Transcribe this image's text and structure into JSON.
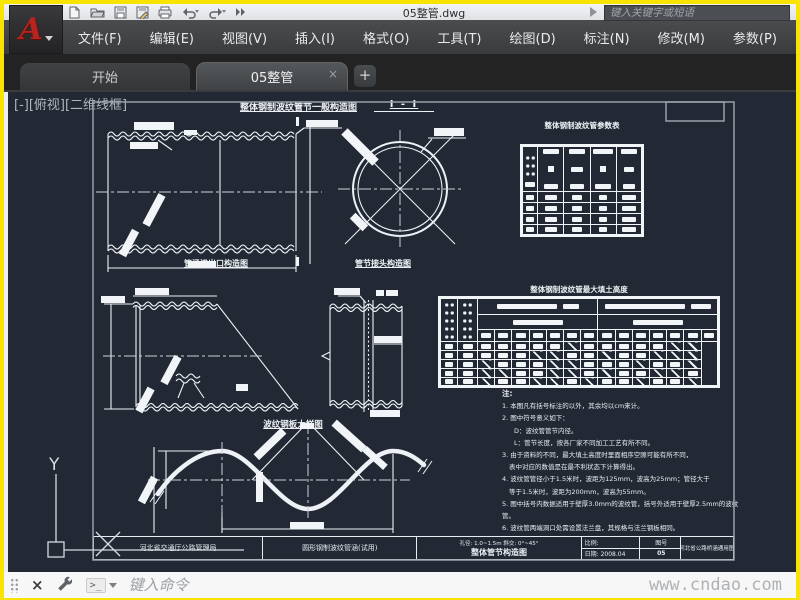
{
  "window": {
    "doc_title": "05整管.dwg",
    "search_placeholder": "键入关键字或短语",
    "qat_icons": [
      "new-file",
      "open-folder",
      "save",
      "save-as",
      "plot",
      "undo",
      "redo",
      "more"
    ],
    "border_color": "#f8e400"
  },
  "menu": {
    "items": [
      "文件(F)",
      "编辑(E)",
      "视图(V)",
      "插入(I)",
      "格式(O)",
      "工具(T)",
      "绘图(D)",
      "标注(N)",
      "修改(M)",
      "参数(P)"
    ]
  },
  "tabs": {
    "start": "开始",
    "active": "05整管",
    "close": "×",
    "new": "+"
  },
  "canvas": {
    "viewport_controls": "[-][俯视][二维线框]",
    "background": "#222834",
    "line_color": "#eef2f6",
    "ucs_y": "Y"
  },
  "drawing": {
    "title_general": "整体钢制波纹管节一般构造图",
    "section_label": "I - I",
    "param_table_title": "整体钢制波纹管参数表",
    "outlet_label": "管涵进出口构造图",
    "joint_label": "管节接头构造图",
    "fill_table_title": "整体钢制波纹管最大填土高度",
    "plate_label": "波纹钢板大样图",
    "notes_title": "注:",
    "notes": [
      "1. 本图凡有括号标注的以外，其余均以cm来计。",
      "2. 图中符号意义如下：",
      "D：波纹管管节内径。",
      "L：管节长度，按各厂家不同加工工艺有所不同。",
      "3. 由于资料的不同，最大填土高度时里面相序空隙可能有所不同，",
      "表中对应的数值是在最不利状态下计算得出。",
      "4. 波纹管管径小于1.5米时，波距为125mm，波高为25mm；管径大于",
      "等于1.5米时，波距为200mm，波高为55mm。",
      "5. 图中括号内数据适用于壁厚3.0mm的波纹管，括号外适用于壁厚2.5mm的波纹管。",
      "6. 波纹管两端洞口处需设置法兰盘，其规格与法兰钢板相同。"
    ],
    "titleblock": {
      "org": "河北省交通厅公路管理局",
      "project": "圆形钢制波纹管涵(试用)",
      "spec": "孔径: 1.0~1.5m  斜交: 0°~45°",
      "sheet_title": "整体管节构造图",
      "scale_label": "比例:",
      "date_label": "日期: 2008.04",
      "no_label": "图号",
      "no_value": "05",
      "series": "河北省公路桥涵通用图"
    }
  },
  "command": {
    "placeholder": "键入命令"
  },
  "watermark": "www.cndao.com"
}
